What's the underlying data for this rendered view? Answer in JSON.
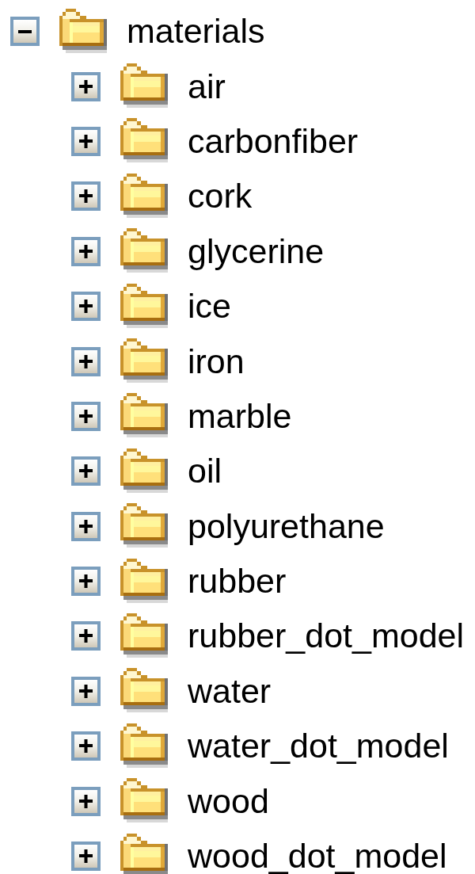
{
  "tree": {
    "label": "materials",
    "expanded": true,
    "children": [
      {
        "label": "air",
        "expanded": false
      },
      {
        "label": "carbonfiber",
        "expanded": false
      },
      {
        "label": "cork",
        "expanded": false
      },
      {
        "label": "glycerine",
        "expanded": false
      },
      {
        "label": "ice",
        "expanded": false
      },
      {
        "label": "iron",
        "expanded": false
      },
      {
        "label": "marble",
        "expanded": false
      },
      {
        "label": "oil",
        "expanded": false
      },
      {
        "label": "polyurethane",
        "expanded": false
      },
      {
        "label": "rubber",
        "expanded": false
      },
      {
        "label": "rubber_dot_model",
        "expanded": false
      },
      {
        "label": "water",
        "expanded": false
      },
      {
        "label": "water_dot_model",
        "expanded": false
      },
      {
        "label": "wood",
        "expanded": false
      },
      {
        "label": "wood_dot_model",
        "expanded": false
      }
    ]
  }
}
